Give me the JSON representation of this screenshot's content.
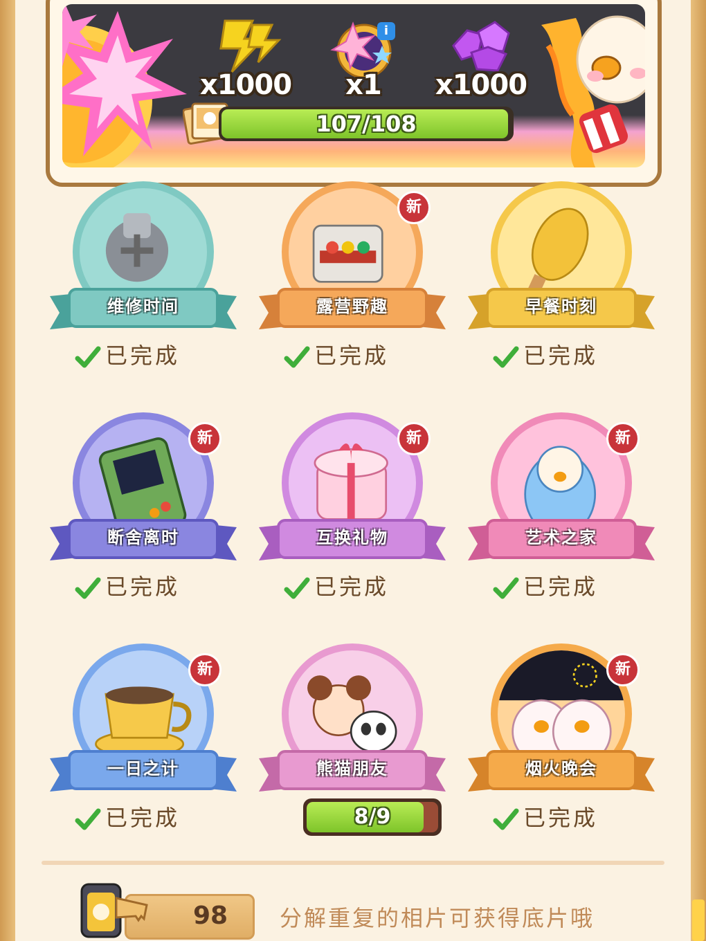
{
  "rewards": [
    {
      "icon": "lightning-icon",
      "count": "x1000"
    },
    {
      "icon": "star-medal-icon",
      "count": "x1",
      "has_info": true
    },
    {
      "icon": "purple-gem-icon",
      "count": "x1000"
    }
  ],
  "info_badge": "i",
  "album_progress": {
    "text": "107/108",
    "current": 107,
    "total": 108
  },
  "new_badge": "新",
  "cards": [
    {
      "title": "维修时间",
      "status": "已完成",
      "is_new": false,
      "theme": "teal"
    },
    {
      "title": "露营野趣",
      "status": "已完成",
      "is_new": true,
      "theme": "orange"
    },
    {
      "title": "早餐时刻",
      "status": "已完成",
      "is_new": false,
      "theme": "yellow"
    },
    {
      "title": "断舍离时",
      "status": "已完成",
      "is_new": true,
      "theme": "purple"
    },
    {
      "title": "互换礼物",
      "status": "已完成",
      "is_new": true,
      "theme": "violet"
    },
    {
      "title": "艺术之家",
      "status": "已完成",
      "is_new": true,
      "theme": "pink"
    },
    {
      "title": "一日之计",
      "status": "已完成",
      "is_new": true,
      "theme": "blue"
    },
    {
      "title": "熊猫朋友",
      "progress": "8/9",
      "progress_current": 8,
      "progress_total": 9,
      "is_new": false,
      "theme": "rose"
    },
    {
      "title": "烟火晚会",
      "status": "已完成",
      "is_new": true,
      "theme": "amber"
    }
  ],
  "footer": {
    "film_count": "98",
    "hint": "分解重复的相片可获得底片哦"
  },
  "theme_colors": {
    "teal": [
      "#7fc9c2",
      "#4aa29b",
      "#9fdbd5"
    ],
    "orange": [
      "#f5a85a",
      "#d6813a",
      "#ffd0a0"
    ],
    "yellow": [
      "#f5c84a",
      "#d6a22a",
      "#ffe79a"
    ],
    "purple": [
      "#8a86e0",
      "#5e58c0",
      "#b6b2f2"
    ],
    "violet": [
      "#d08ae0",
      "#a95ec0",
      "#ecc0f4"
    ],
    "pink": [
      "#f08ab8",
      "#d05e96",
      "#ffc2dc"
    ],
    "blue": [
      "#7aa8ec",
      "#4e7fcf",
      "#b8d2f8"
    ],
    "rose": [
      "#e89ad0",
      "#c46aa8",
      "#f8cfe8"
    ],
    "amber": [
      "#f5aa4a",
      "#d6842a",
      "#ffd59a"
    ]
  }
}
